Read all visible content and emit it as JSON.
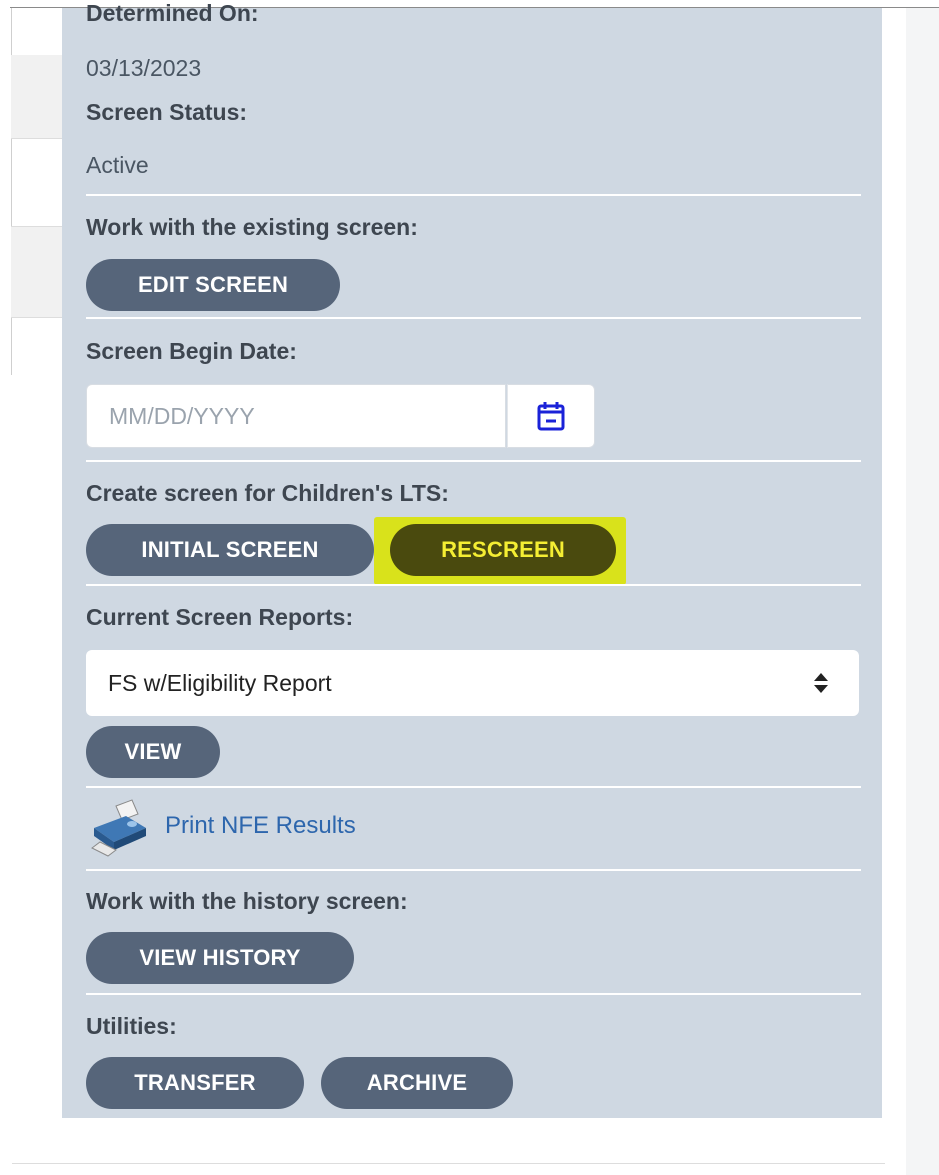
{
  "panel": {
    "determined_on_label": "Determined On:",
    "determined_on_value": "03/13/2023",
    "screen_status_label": "Screen Status:",
    "screen_status_value": "Active",
    "existing_screen_label": "Work with the existing screen:",
    "edit_screen_button": "EDIT SCREEN",
    "begin_date_label": "Screen Begin Date:",
    "begin_date_placeholder": "MM/DD/YYYY",
    "children_lts_label": "Create screen for Children's LTS:",
    "initial_screen_button": "INITIAL SCREEN",
    "rescreen_button": "RESCREEN",
    "current_reports_label": "Current Screen Reports:",
    "report_selected": "FS w/Eligibility Report",
    "view_button": "VIEW",
    "print_link": "Print NFE Results",
    "history_label": "Work with the history screen:",
    "view_history_button": "VIEW HISTORY",
    "utilities_label": "Utilities:",
    "transfer_button": "TRANSFER",
    "archive_button": "ARCHIVE"
  },
  "icons": {
    "calendar": "calendar-icon",
    "select": "sort-arrows-icon",
    "printer": "printer-icon"
  },
  "colors": {
    "panel_bg": "#cfd8e2",
    "pill_bg": "#56657a",
    "highlight": "#d9e21b",
    "link": "#2d66ad",
    "calendar_icon": "#1a22d8"
  }
}
